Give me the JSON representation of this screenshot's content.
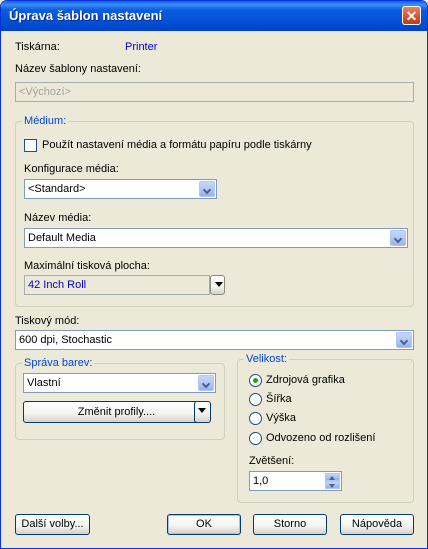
{
  "window": {
    "title": "Úprava šablon nastavení",
    "close_glyph": "✕"
  },
  "printer": {
    "label": "Tiskárna:",
    "value": "Printer"
  },
  "template_name": {
    "label": "Název šablony nastavení:",
    "placeholder": "<Výchozí>"
  },
  "media": {
    "group_title": "Médium:",
    "use_printer_checkbox": {
      "label": "Použít nastavení média a formátu papíru podle tiskárny",
      "checked": false
    },
    "config": {
      "label": "Konfigurace média:",
      "value": "<Standard>"
    },
    "name": {
      "label": "Název média:",
      "value": "Default Media"
    },
    "max_area": {
      "label": "Maximální tisková plocha:",
      "value": "42 Inch Roll"
    }
  },
  "print_mode": {
    "label": "Tiskový mód:",
    "value": "600 dpi, Stochastic"
  },
  "color": {
    "group_title": "Správa barev:",
    "value": "Vlastní",
    "change_profiles_button": "Změnit profily...."
  },
  "size": {
    "group_title": "Velikost:",
    "options": [
      {
        "label": "Zdrojová grafika",
        "selected": true
      },
      {
        "label": "Šířka",
        "selected": false
      },
      {
        "label": "Výška",
        "selected": false
      },
      {
        "label": "Odvozeno od rozlišení",
        "selected": false
      }
    ],
    "zoom": {
      "label": "Zvětšení:",
      "value": "1,0"
    }
  },
  "buttons": {
    "more": "Další volby...",
    "ok": "OK",
    "cancel": "Storno",
    "help": "Nápověda"
  },
  "colors": {
    "titlebar": "#0350d6",
    "group_title": "#0046d5",
    "link_value": "#0000cc"
  }
}
